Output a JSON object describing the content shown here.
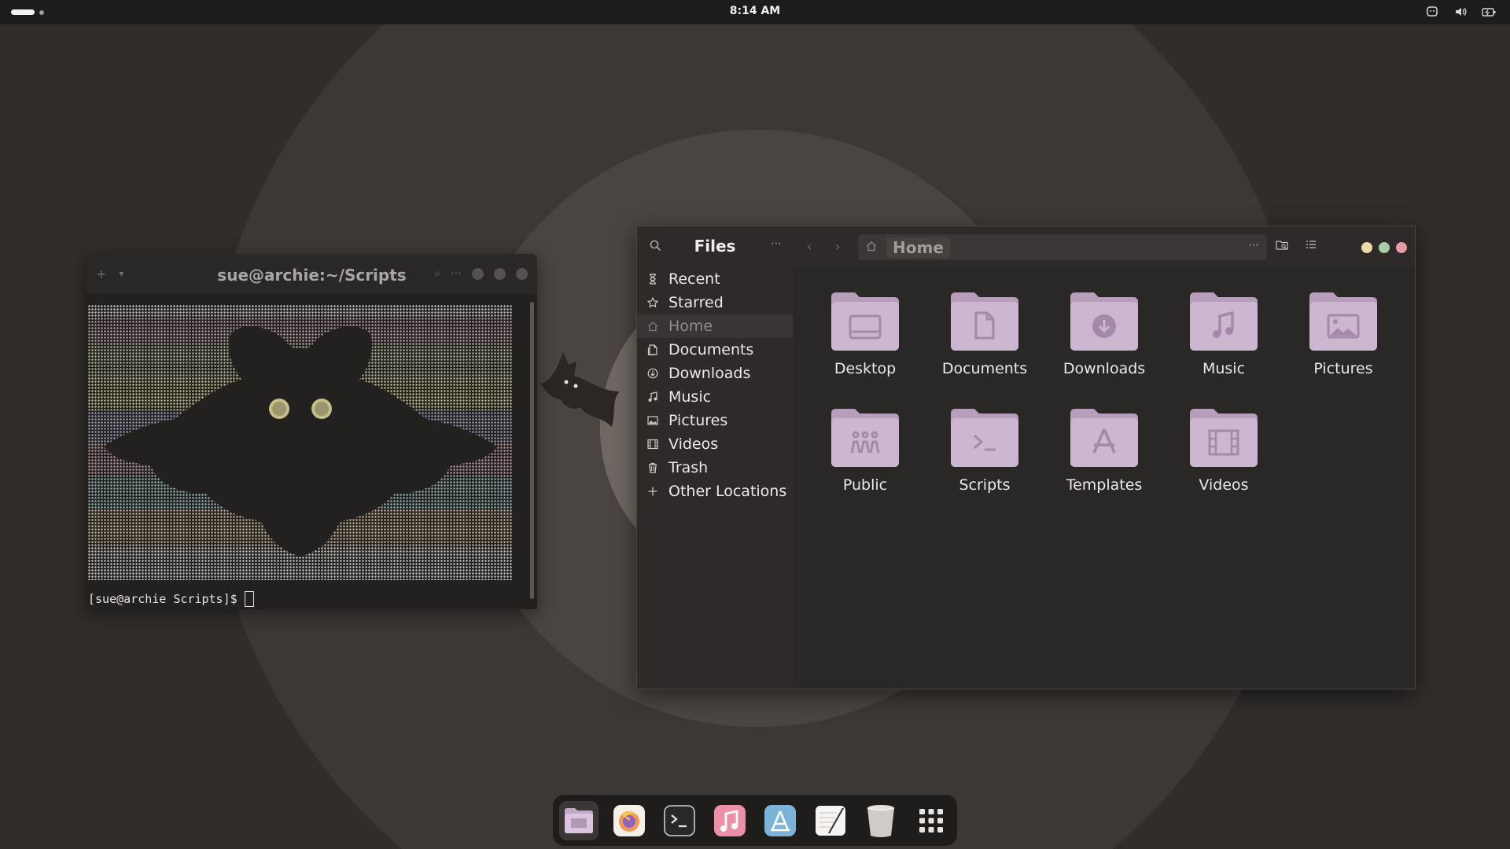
{
  "topbar": {
    "clock": "8:14 AM",
    "tray_icons": [
      "shield-icon",
      "volume-icon",
      "battery-icon"
    ]
  },
  "terminal": {
    "title": "sue@archie:~/Scripts",
    "prompt": "[sue@archie Scripts]$"
  },
  "files": {
    "sidebar_title": "Files",
    "sidebar_items": [
      {
        "label": "Recent",
        "icon": "clock-icon"
      },
      {
        "label": "Starred",
        "icon": "star-icon"
      },
      {
        "label": "Home",
        "icon": "home-icon",
        "active": true
      },
      {
        "label": "Documents",
        "icon": "document-icon"
      },
      {
        "label": "Downloads",
        "icon": "download-icon"
      },
      {
        "label": "Music",
        "icon": "music-icon"
      },
      {
        "label": "Pictures",
        "icon": "image-icon"
      },
      {
        "label": "Videos",
        "icon": "film-icon"
      },
      {
        "label": "Trash",
        "icon": "trash-icon"
      },
      {
        "label": "Other Locations",
        "icon": "plus-icon"
      }
    ],
    "path": "Home",
    "folders": [
      {
        "label": "Desktop",
        "icon": "desktop-icon"
      },
      {
        "label": "Documents",
        "icon": "document-icon"
      },
      {
        "label": "Downloads",
        "icon": "download-icon"
      },
      {
        "label": "Music",
        "icon": "music-icon"
      },
      {
        "label": "Pictures",
        "icon": "image-icon"
      },
      {
        "label": "Public",
        "icon": "people-icon"
      },
      {
        "label": "Scripts",
        "icon": "terminal-icon"
      },
      {
        "label": "Templates",
        "icon": "templates-icon"
      },
      {
        "label": "Videos",
        "icon": "film-icon"
      }
    ],
    "window_button_colors": [
      "#f0d9a8",
      "#a7cfa7",
      "#e89aa3"
    ]
  },
  "dock": {
    "apps": [
      "files-app-icon",
      "firefox-icon",
      "terminal-app-icon",
      "music-app-icon",
      "software-center-icon",
      "text-editor-icon",
      "trash-app-icon",
      "app-grid-icon"
    ]
  },
  "colors": {
    "folder": "#cdb6cf",
    "folder_tab": "#b79fbb",
    "accent": "#e0a0c0"
  }
}
